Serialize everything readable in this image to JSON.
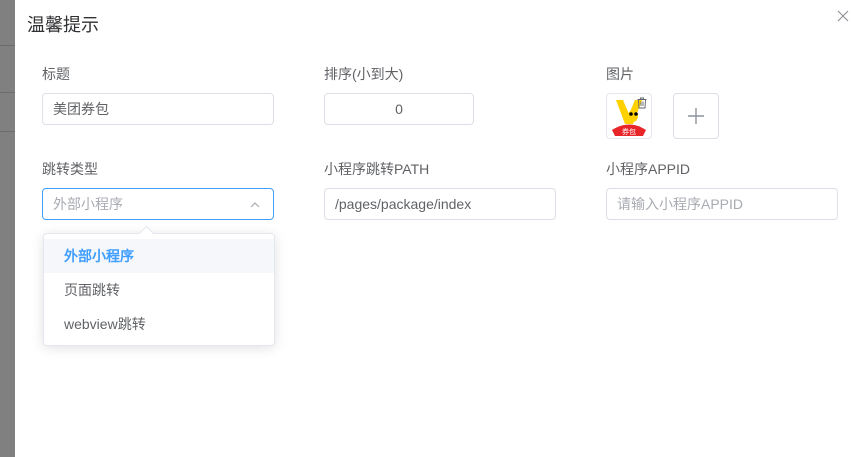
{
  "dialog": {
    "title": "温馨提示"
  },
  "form": {
    "title_field": {
      "label": "标题",
      "value": "美团券包"
    },
    "sort_field": {
      "label": "排序(小到大)",
      "value": "0"
    },
    "image_field": {
      "label": "图片",
      "thumb_caption": "券包"
    },
    "jump_type_field": {
      "label": "跳转类型",
      "selected": "外部小程序",
      "options": [
        "外部小程序",
        "页面跳转",
        "webview跳转"
      ]
    },
    "path_field": {
      "label": "小程序跳转PATH",
      "value": "/pages/package/index"
    },
    "appid_field": {
      "label": "小程序APPID",
      "placeholder": "请输入小程序APPID"
    }
  },
  "colors": {
    "primary": "#409eff",
    "thumb_yellow": "#ffd100",
    "thumb_red": "#e8262a"
  },
  "icons": [
    "close-icon",
    "chevron-up-icon",
    "delete-icon",
    "plus-icon"
  ]
}
